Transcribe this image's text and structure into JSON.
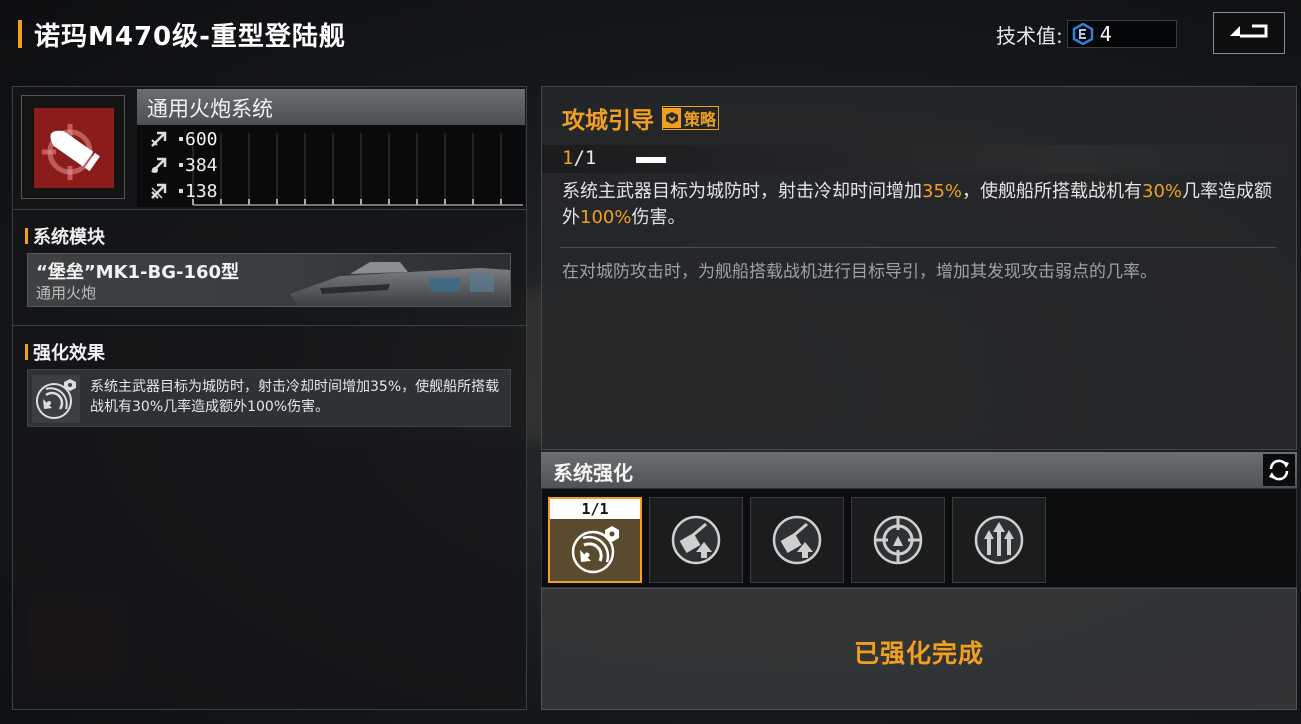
{
  "header": {
    "title": "诺玛M470级-重型登陆舰",
    "tech_label": "技术值:",
    "tech_value": "4",
    "back_icon": "return-arrow-icon"
  },
  "system": {
    "name": "通用火炮系统",
    "icon": "artillery-shell-target-icon",
    "stats": [
      {
        "icon": "damage-arrow-icon",
        "value": "600"
      },
      {
        "icon": "rate-arrow-icon",
        "value": "384"
      },
      {
        "icon": "range-arrow-icon",
        "value": "138"
      }
    ]
  },
  "module_section": {
    "title": "系统模块",
    "module_name": "“堡垒”MK1-BG-160型",
    "module_type": "通用火炮"
  },
  "effect_section": {
    "title": "强化效果",
    "icon": "radar-satellite-icon",
    "text": "系统主武器目标为城防时，射击冷却时间增加35%，使舰船所搭载战机有30%几率造成额外100%伤害。"
  },
  "skill": {
    "name": "攻城引导",
    "tag": "策略",
    "level_current": "1",
    "level_sep": "/",
    "level_max": "1",
    "desc_parts": [
      "系统主武器目标为城防时，射击冷却时间增加",
      "35%",
      "，使舰船所搭载战机有",
      "30%",
      "几率造成额外",
      "100%",
      "伤害。"
    ],
    "flavor": "在对城防攻击时，为舰船搭载战机进行目标导引，增加其发现攻击弱点的几率。"
  },
  "enhancement": {
    "title": "系统强化",
    "refresh_icon": "refresh-icon",
    "slots": [
      {
        "icon": "radar-satellite-icon",
        "level": "1/1",
        "active": true
      },
      {
        "icon": "turret-upgrade-icon",
        "active": false
      },
      {
        "icon": "turret-upgrade-icon",
        "active": false
      },
      {
        "icon": "crosshair-target-icon",
        "active": false
      },
      {
        "icon": "triple-arrow-up-icon",
        "active": false
      }
    ],
    "status": "已强化完成"
  },
  "colors": {
    "accent": "#f0a01e",
    "icon_red": "#8c1b1b",
    "tech_blue": "#3a7bd5"
  }
}
